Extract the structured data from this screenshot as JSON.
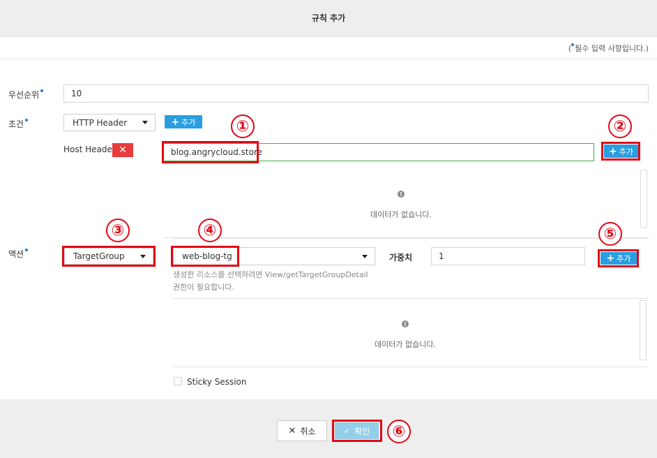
{
  "dialog": {
    "title": "규칙 추가",
    "required_note_prefix": "(",
    "required_note_text": "필수 입력 사항입니다.)"
  },
  "priority": {
    "label": "우선순위",
    "value": "10"
  },
  "condition": {
    "label": "조건",
    "type_selected": "HTTP Header",
    "add_label": "추가",
    "host_header_label": "Host Header",
    "host_value": "blog.angrycloud.store",
    "row_add_label": "추가",
    "empty_text": "데이터가 없습니다."
  },
  "action": {
    "label": "액션",
    "type_selected": "TargetGroup",
    "target_selected": "web-blog-tg",
    "weight_label": "가중치",
    "weight_value": "1",
    "add_label": "추가",
    "hint_line1": "생성한 리소스를 선택하려면 View/getTargetGroupDetail",
    "hint_line2": "권한이 필요합니다.",
    "empty_text": "데이터가 없습니다.",
    "sticky_label": "Sticky Session"
  },
  "footer": {
    "cancel_label": "취소",
    "ok_label": "확인"
  },
  "markers": [
    "①",
    "②",
    "③",
    "④",
    "⑤",
    "⑥"
  ],
  "colors": {
    "accent": "#2a9ee0",
    "marker_red": "#e30613",
    "delete_red": "#e73c3c",
    "valid_green": "#48b04b"
  }
}
